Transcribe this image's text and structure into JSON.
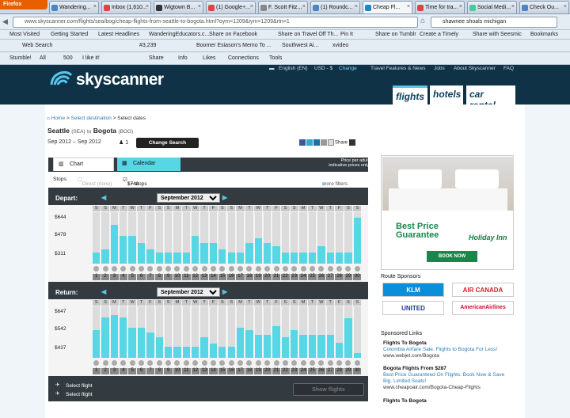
{
  "browser": {
    "app_button": "Firefox",
    "tabs": [
      {
        "label": "Wandering...",
        "fav": "#4a86c5"
      },
      {
        "label": "Inbox (1,610...",
        "fav": "#d44"
      },
      {
        "label": "Wigtown B...",
        "fav": "#333"
      },
      {
        "label": "(1) Google+...",
        "fav": "#d44"
      },
      {
        "label": "F. Scott Fitz...",
        "fav": "#888"
      },
      {
        "label": "(1) Roundc...",
        "fav": "#4a86c5"
      },
      {
        "label": "Cheap Fl...",
        "fav": "#1b88c9"
      },
      {
        "label": "Time for tra...",
        "fav": "#d44"
      },
      {
        "label": "Social Medi...",
        "fav": "#4c9"
      },
      {
        "label": "Check Ou...",
        "fav": "#4a86c5"
      }
    ],
    "url": "www.skyscanner.com/flights/sea/bog/cheap-flights-from-seattle-to-bogota.html?oym=1209&iym=1209&rtn=1",
    "search_query": "shawnee shoals michigan",
    "bookmarks": [
      "Most Visited",
      "Getting Started",
      "Latest Headlines",
      "WanderingEducators.c...",
      "Share on Facebook",
      "Share on Travel Off Th...",
      "Pin It",
      "Share on Tumblr",
      "Create a Timely",
      "Share with Seesmic",
      "Bookmarks"
    ],
    "toolbar1": [
      "Web Search",
      "#3,239",
      "Boomer Esiason's Memo To ...",
      "Southwest Ai...",
      "xvideo"
    ],
    "toolbar2": [
      "Stumble!",
      "All",
      "500",
      "I like it!",
      "Share",
      "Info",
      "Likes",
      "Connections",
      "Tools"
    ]
  },
  "site": {
    "logo": "skyscanner",
    "language": "English (EN)",
    "currency": "USD - $",
    "change": "Change",
    "links": [
      "Travel Features & News",
      "Jobs",
      "About Skyscanner",
      "FAQ"
    ],
    "nav": [
      "flights",
      "hotels",
      "car rental"
    ]
  },
  "breadcrumb": {
    "home": "Home",
    "sep1": ">",
    "dest": "Select destination",
    "sep2": ">",
    "current": "Select dates"
  },
  "route": {
    "from": "Seattle",
    "from_code": "(SEA)",
    "to_word": "to",
    "to": "Bogota",
    "to_code": "(BOG)"
  },
  "dates": "Sep 2012 – Sep 2012",
  "pax": "1",
  "change_search": "Change Search",
  "share_label": "Share",
  "chart_tabs": {
    "chart": "Chart",
    "calendar": "Calendar"
  },
  "price_note": "Price per adult\nindicative prices only",
  "stops": {
    "label": "Stops:",
    "direct": "Direct (none)",
    "onestop": "1+ stops",
    "price": "$748",
    "more": "more filters"
  },
  "depart": {
    "label": "Depart:",
    "month": "September 2012",
    "y_ticks": [
      "$644",
      "$478",
      "$311"
    ],
    "days": [
      "S",
      "S",
      "M",
      "T",
      "W",
      "T",
      "F",
      "S",
      "S",
      "M",
      "T",
      "W",
      "T",
      "F",
      "S",
      "S",
      "M",
      "T",
      "W",
      "T",
      "F",
      "S",
      "S",
      "M",
      "T",
      "W",
      "T",
      "F",
      "S",
      "S"
    ],
    "dates": [
      1,
      2,
      3,
      4,
      5,
      6,
      7,
      8,
      9,
      10,
      11,
      12,
      13,
      14,
      15,
      16,
      17,
      18,
      19,
      20,
      21,
      22,
      23,
      24,
      25,
      26,
      27,
      28,
      29,
      30
    ],
    "values": [
      0.22,
      0.28,
      0.76,
      0.55,
      0.55,
      0.4,
      0.28,
      0.22,
      0.22,
      0.22,
      0.22,
      0.55,
      0.4,
      0.4,
      0.28,
      0.22,
      0.22,
      0.4,
      0.5,
      0.4,
      0.35,
      0.22,
      0.22,
      0.22,
      0.22,
      0.35,
      0.22,
      0.22,
      0.22,
      0.9
    ]
  },
  "return": {
    "label": "Return:",
    "month": "September 2012",
    "y_ticks": [
      "$647",
      "$542",
      "$437"
    ],
    "days": [
      "S",
      "S",
      "M",
      "T",
      "W",
      "T",
      "F",
      "S",
      "S",
      "M",
      "T",
      "W",
      "T",
      "F",
      "S",
      "S",
      "M",
      "T",
      "W",
      "T",
      "F",
      "S",
      "S",
      "M",
      "T",
      "W",
      "T",
      "F",
      "S",
      "S"
    ],
    "dates": [
      1,
      2,
      3,
      4,
      5,
      6,
      7,
      8,
      9,
      10,
      11,
      12,
      13,
      14,
      15,
      16,
      17,
      18,
      19,
      20,
      21,
      22,
      23,
      24,
      25,
      26,
      27,
      28,
      29,
      30
    ],
    "values": [
      0.55,
      0.8,
      0.85,
      0.8,
      0.6,
      0.6,
      0.5,
      0.4,
      0.22,
      0.22,
      0.22,
      0.22,
      0.4,
      0.28,
      0.22,
      0.22,
      0.6,
      0.55,
      0.45,
      0.45,
      0.62,
      0.4,
      0.55,
      0.45,
      0.45,
      0.45,
      0.45,
      0.3,
      0.78,
      0.1
    ]
  },
  "footer": {
    "select1": "Select flight",
    "select2": "Select flight",
    "show": "Show flights"
  },
  "ad": {
    "line1": "Best Price",
    "line2": "Guarantee",
    "brand": "Holiday Inn",
    "cta": "BOOK NOW"
  },
  "sponsors_title": "Route Sponsors",
  "sponsors": [
    "KLM",
    "AIR CANADA",
    "UNITED",
    "AmericanAirlines"
  ],
  "sponsored_title": "Sponsored Links",
  "sponsored_links": [
    {
      "title": "Flights To Bogota",
      "desc": "Colombia Airfare Sale. Flights to Bogota For Less!",
      "url": "www.webjet.com/Bogota"
    },
    {
      "title": "Bogota Flights From $287",
      "desc": "Best Price Guaranteed On Flights. Book Now & Save Big. Limited Seats!",
      "url": "www.cheapoair.com/Bogota-Cheap-Flights"
    },
    {
      "title": "Flights To Bogota",
      "desc": "",
      "url": ""
    }
  ]
}
